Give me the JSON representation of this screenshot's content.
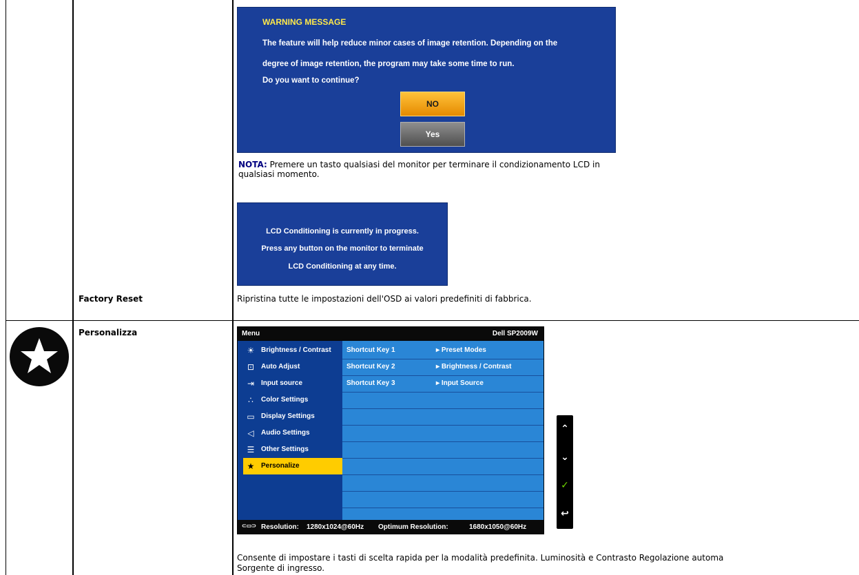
{
  "left_column": {
    "factory_reset_label": "Factory Reset",
    "personalize_label": "Personalizza"
  },
  "warning_dialog": {
    "title": "WARNING MESSAGE",
    "line1": "The feature will help reduce minor cases of image retention. Depending on the",
    "line2": "degree of  image  retention, the program may take some time to run.",
    "line3": "Do you want to continue?",
    "no_button": "NO",
    "yes_button": "Yes"
  },
  "note": {
    "label": "NOTA:",
    "text": "Premere un tasto qualsiasi del monitor per terminare il condizionamento LCD in qualsiasi momento."
  },
  "lcd_box": {
    "line1": "LCD Conditioning is currently in progress.",
    "line2": "Press any button on the monitor to terminate",
    "line3": "LCD Conditioning at any time."
  },
  "factory_reset_desc": "Ripristina tutte le impostazioni dell'OSD ai valori predefiniti di fabbrica.",
  "osd": {
    "menu_title": "Menu",
    "model": "Dell SP2009W",
    "menu_items": [
      {
        "icon": "brightness-icon",
        "label": "Brightness / Contrast"
      },
      {
        "icon": "auto-adjust-icon",
        "label": "Auto Adjust"
      },
      {
        "icon": "input-source-icon",
        "label": "Input source"
      },
      {
        "icon": "color-settings-icon",
        "label": "Color Settings"
      },
      {
        "icon": "display-settings-icon",
        "label": "Display Settings"
      },
      {
        "icon": "audio-settings-icon",
        "label": "Audio Settings"
      },
      {
        "icon": "other-settings-icon",
        "label": "Other Settings"
      },
      {
        "icon": "star-icon",
        "label": "Personalize"
      }
    ],
    "selected_item": "Personalize",
    "shortcuts": [
      {
        "key": "Shortcut Key 1",
        "value": "Preset Modes"
      },
      {
        "key": "Shortcut Key 2",
        "value": "Brightness / Contrast"
      },
      {
        "key": "Shortcut Key 3",
        "value": "Input Source"
      }
    ],
    "resolution_label": "Resolution:",
    "resolution": "1280x1024@60Hz",
    "optimum_label": "Optimum Resolution:",
    "optimum": "1680x1050@60Hz"
  },
  "nav_buttons": [
    "up-arrow-icon",
    "down-arrow-icon",
    "check-icon",
    "back-icon"
  ],
  "personalize_desc_line1": "Consente di impostare i tasti di scelta rapida per la modalità predefinita. Luminosità e Contrasto Regolazione automa",
  "personalize_desc_line2": "Sorgente di ingresso.",
  "colors": {
    "dialog_blue": "#1a3f99",
    "button_orange": "#f5a10a",
    "highlight_yellow": "#ffcc00"
  }
}
